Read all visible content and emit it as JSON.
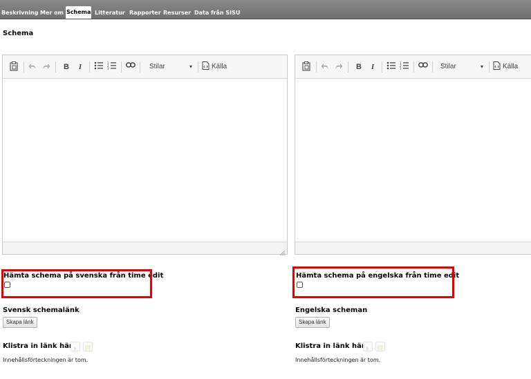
{
  "tabs": [
    {
      "label": "Beskrivning",
      "active": false
    },
    {
      "label": "Mer om",
      "active": false
    },
    {
      "label": "Schema",
      "active": true
    },
    {
      "label": "Litteratur",
      "active": false
    },
    {
      "label": "Rapporter",
      "active": false
    },
    {
      "label": "Resurser",
      "active": false
    },
    {
      "label": "Data från SISU",
      "active": false
    }
  ],
  "page_title": "Schema",
  "editor_toolbar": {
    "styles_label": "Stilar",
    "dropdown_arrow": "▾",
    "source_label": "Källa",
    "icons": [
      "paste-icon",
      "undo-icon",
      "redo-icon",
      "bold-icon",
      "italic-icon",
      "bulleted-list-icon",
      "numbered-list-icon",
      "link-icon",
      "source-icon"
    ],
    "bold_glyph": "B",
    "italic_glyph": "I"
  },
  "swedish": {
    "fetch_label": "Hämta schema på svenska från time edit",
    "fetch_checked": false,
    "link_heading": "Svensk schemalänk",
    "create_button": "Skapa länk",
    "paste_heading": "Klistra in länk här",
    "empty_text": "Innehållsförteckningen är tom."
  },
  "english": {
    "fetch_label": "Hämta schema på engelska från time edit",
    "fetch_checked": false,
    "link_heading": "Engelska scheman",
    "create_button": "Skapa länk",
    "paste_heading": "Klistra in länk här",
    "empty_text": "Innehållsförteckningen är tom."
  },
  "colors": {
    "tabbar": "#7a7a7a",
    "highlight": "#e60000"
  }
}
